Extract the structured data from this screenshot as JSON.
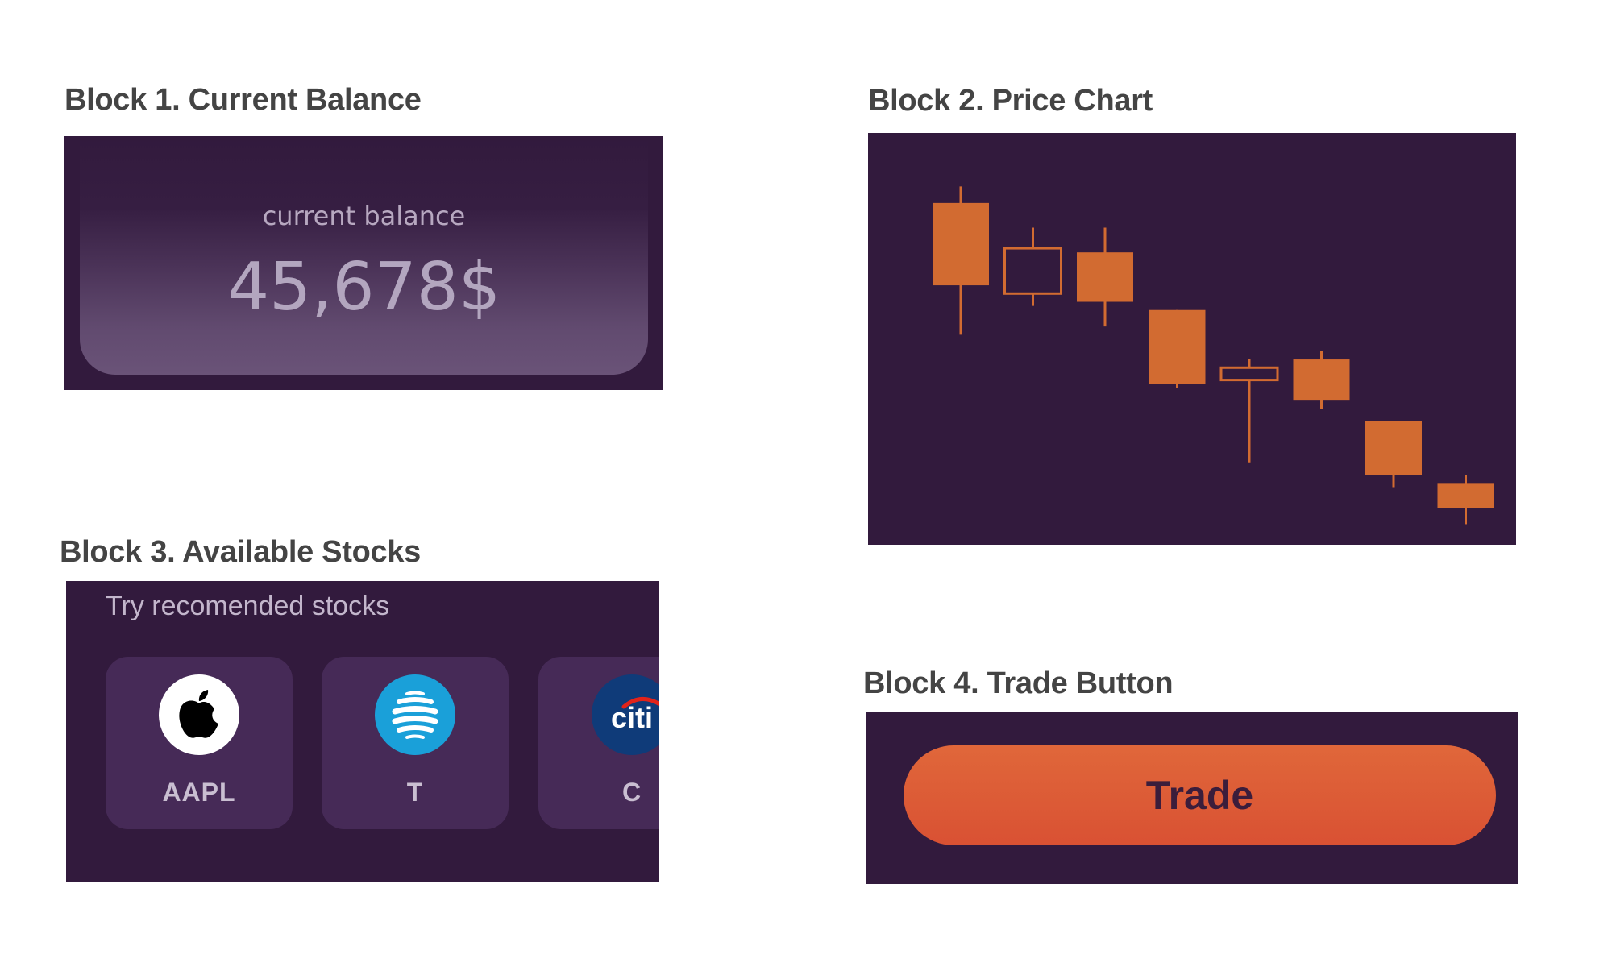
{
  "blocks": {
    "block1_title": "Block 1. Current Balance",
    "block2_title": "Block 2. Price Chart",
    "block3_title": "Block 3. Available Stocks",
    "block4_title": "Block 4. Trade Button"
  },
  "balance": {
    "label": "current balance",
    "value": "45,678$"
  },
  "stocks": {
    "prompt": "Try recomended stocks",
    "items": [
      {
        "ticker": "AAPL",
        "icon": "apple-logo-icon"
      },
      {
        "ticker": "T",
        "icon": "att-globe-logo-icon"
      },
      {
        "ticker": "C",
        "icon": "citi-logo-icon",
        "logo_text": "citi"
      }
    ]
  },
  "trade": {
    "label": "Trade"
  },
  "colors": {
    "panel_bg": "#321a3d",
    "candle": "#d26b31",
    "card_bg": "#462a57",
    "button_top": "#e0673a",
    "button_bottom": "#d95133",
    "button_text": "#3b1d3b"
  },
  "chart_data": {
    "type": "candlestick",
    "axes_visible": false,
    "grid": false,
    "candles": [
      {
        "open": 83,
        "close": 63,
        "high": 87,
        "low": 51,
        "filled": true
      },
      {
        "open": 61,
        "close": 72,
        "high": 77,
        "low": 58,
        "filled": false
      },
      {
        "open": 71,
        "close": 59,
        "high": 77,
        "low": 53,
        "filled": true
      },
      {
        "open": 57,
        "close": 39,
        "high": 57,
        "low": 38,
        "filled": true
      },
      {
        "open": 40,
        "close": 43,
        "high": 45,
        "low": 20,
        "filled": false
      },
      {
        "open": 45,
        "close": 35,
        "high": 47,
        "low": 33,
        "filled": true
      },
      {
        "open": 30,
        "close": 17,
        "high": 30,
        "low": 14,
        "filled": true
      },
      {
        "open": 15,
        "close": 9,
        "high": 17,
        "low": 5,
        "filled": true
      }
    ],
    "ylim": [
      0,
      100
    ]
  }
}
